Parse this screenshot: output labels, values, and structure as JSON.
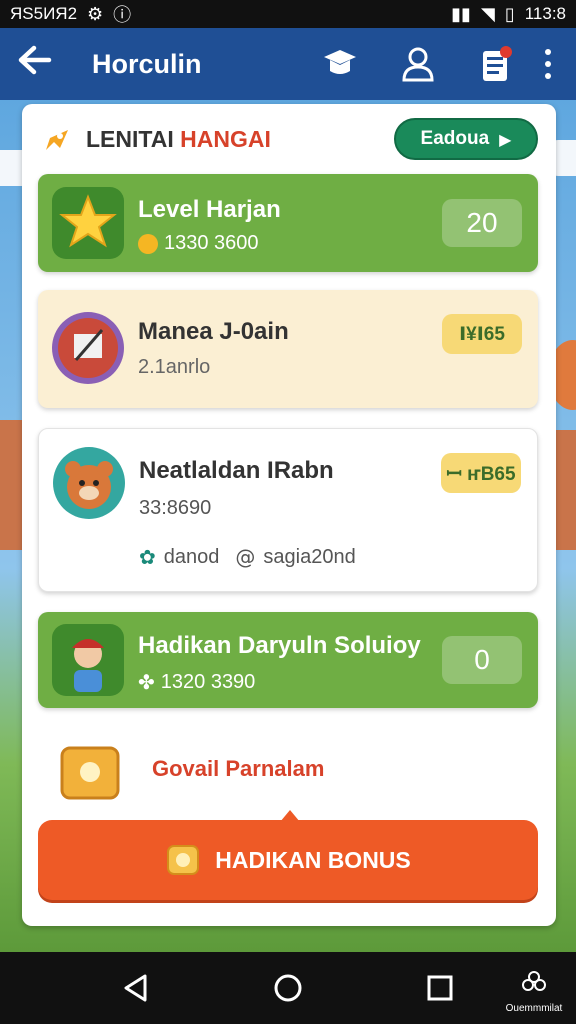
{
  "status_bar": {
    "left_text": "ЯS5ИЯ2",
    "right_text": "113:8"
  },
  "app_bar": {
    "title": "Horculin"
  },
  "panel": {
    "title_part1": "LENITAI",
    "title_part2": "HANGAI",
    "header_button": "Eadoua"
  },
  "list": [
    {
      "name": "Level Harjan",
      "sub": "1330 3600",
      "score": "20"
    },
    {
      "name": "Manea J-0ain",
      "sub": "2.1anrlo",
      "score": "Ⅰ¥Ⅰ65"
    },
    {
      "name": "Neatlaldan IRabn",
      "sub": "33:8690",
      "extra_a": "danod",
      "extra_b": "sagia20nd",
      "score": "ꟷ ҥB65"
    },
    {
      "name": "Hadikan Daryuln Soluioy",
      "sub": "1320 3390",
      "score": "0"
    }
  ],
  "bonus": {
    "label": "Govail Parnalam",
    "button": "HADIKAN BONUS"
  },
  "nav": {
    "extra_label": "Ouemmmilat"
  },
  "colors": {
    "appbar": "#1f4f95",
    "green": "#6fae44",
    "cream": "#fbefd3",
    "orange": "#ee5a26",
    "teal_button": "#1a8a5a"
  }
}
